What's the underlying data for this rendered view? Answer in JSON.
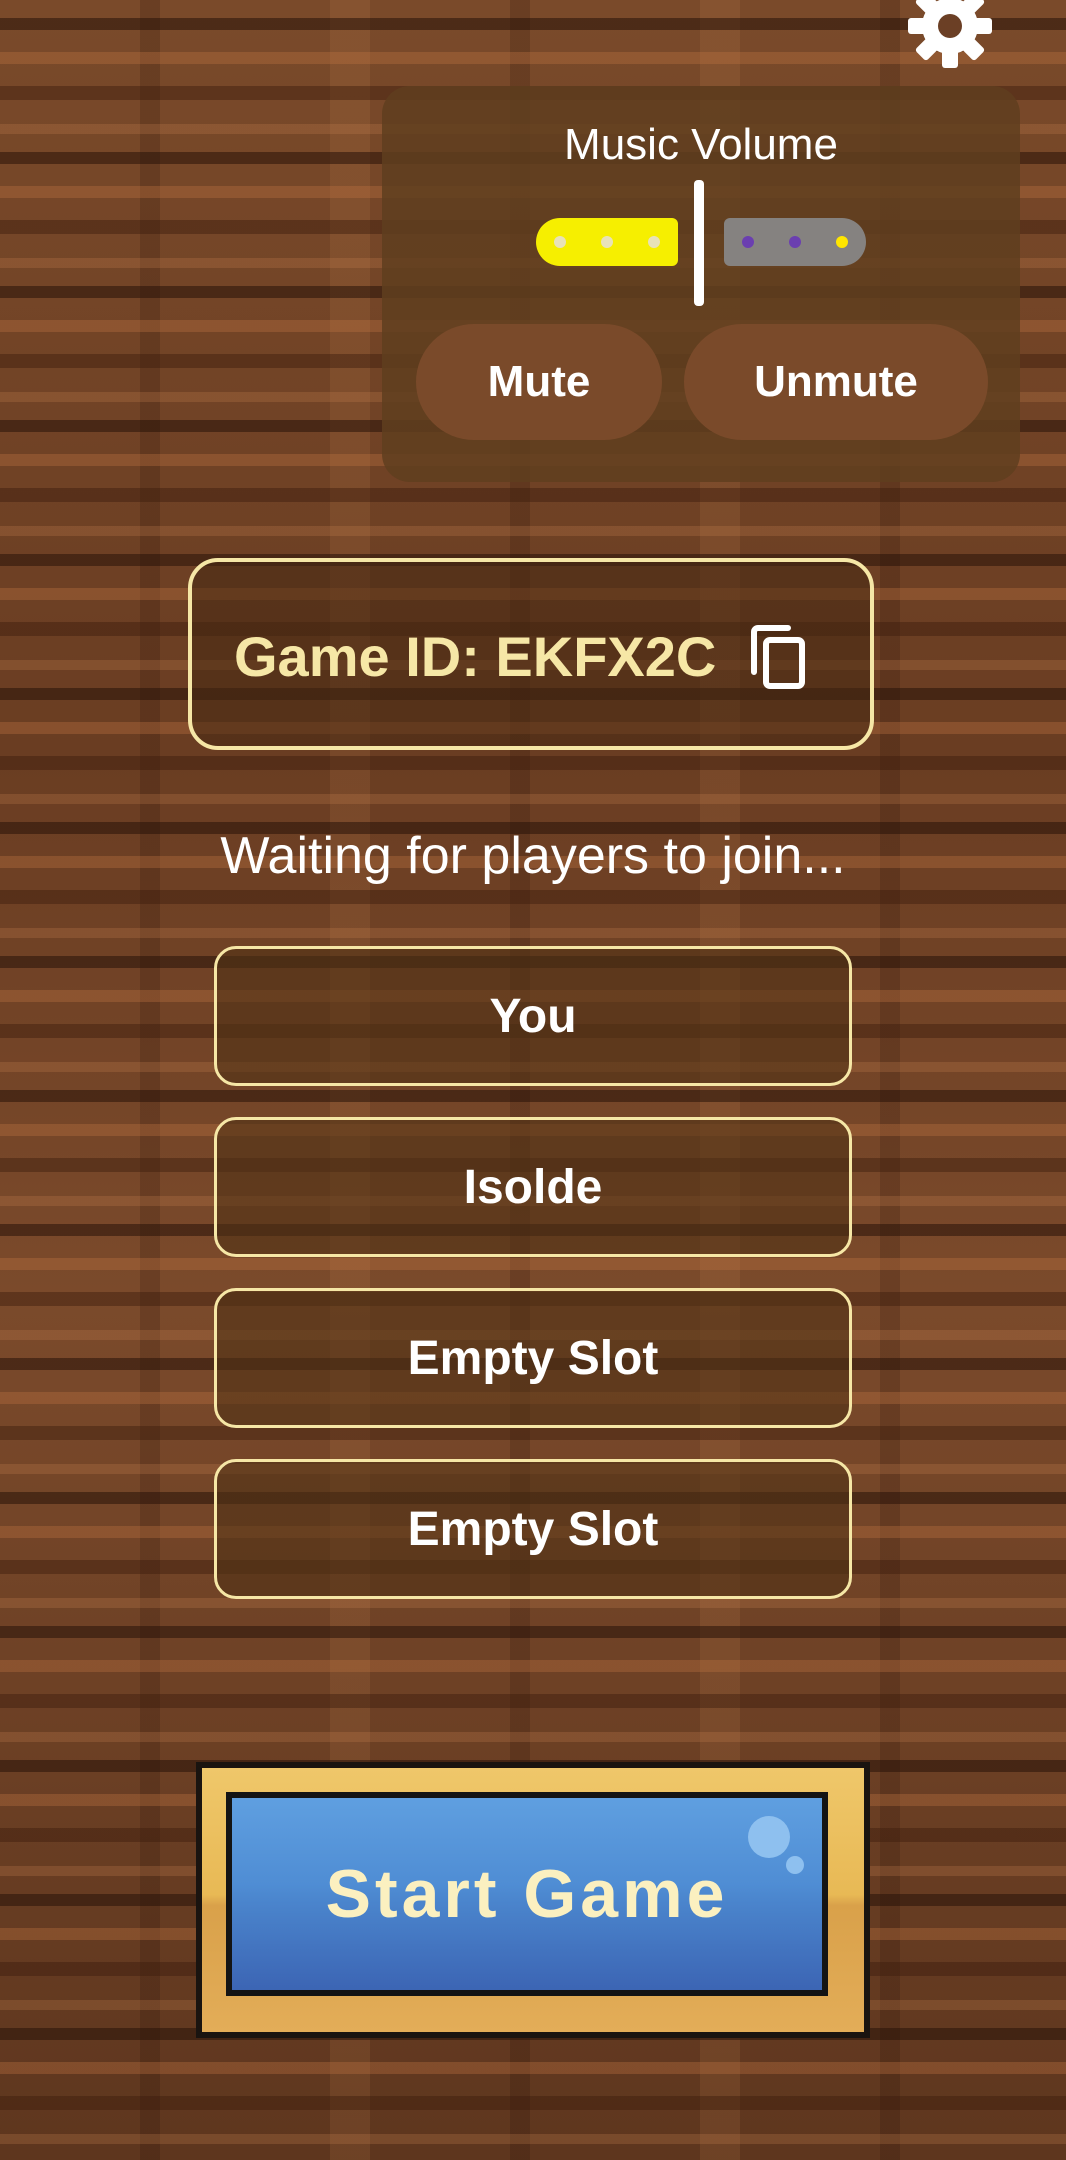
{
  "volume_panel": {
    "title": "Music Volume",
    "volume_level": 0.5,
    "mute_label": "Mute",
    "unmute_label": "Unmute"
  },
  "lobby": {
    "game_id_text": "Game ID: EKFX2C",
    "status_text": "Waiting for players to join...",
    "player_slots": [
      "You",
      "Isolde",
      "Empty Slot",
      "Empty Slot"
    ],
    "start_label": "Start Game"
  },
  "icons": {
    "settings": "gear-icon",
    "copy": "copy-icon"
  },
  "colors": {
    "slider_fill": "#f6ef00",
    "slider_track": "#858280",
    "accent_border": "#f6e7a6",
    "start_button": "#4f8dd4",
    "start_frame": "#e8b955"
  }
}
